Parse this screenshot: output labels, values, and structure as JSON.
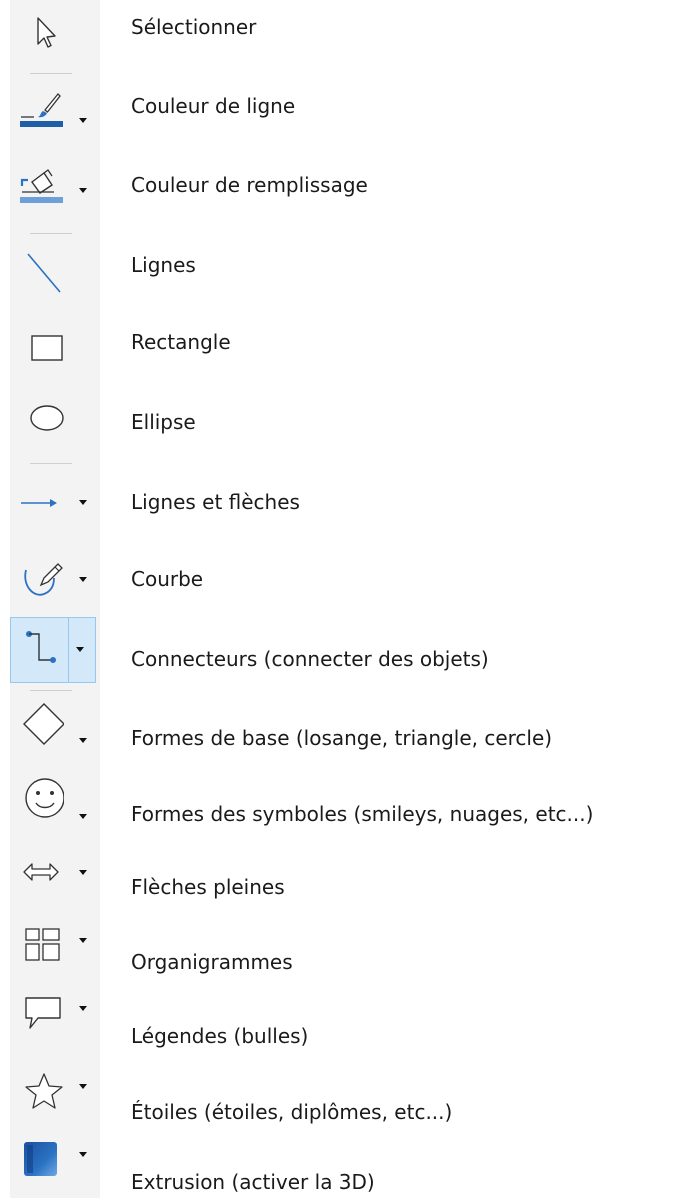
{
  "tools": [
    {
      "label": "Sélectionner"
    },
    {
      "label": "Couleur de ligne"
    },
    {
      "label": "Couleur de remplissage"
    },
    {
      "label": "Lignes"
    },
    {
      "label": "Rectangle"
    },
    {
      "label": "Ellipse"
    },
    {
      "label": "Lignes et  flèches"
    },
    {
      "label": "Courbe"
    },
    {
      "label": "Connecteurs (connecter des objets)"
    },
    {
      "label": "Formes de base (losange, triangle, cercle)"
    },
    {
      "label": "Formes des symboles (smileys, nuages, etc...)"
    },
    {
      "label": "Flèches pleines"
    },
    {
      "label": "Organigrammes"
    },
    {
      "label": "Légendes (bulles)"
    },
    {
      "label": "Étoiles (étoiles, diplômes, etc...)"
    },
    {
      "label": "Extrusion (activer la 3D)"
    }
  ],
  "colors": {
    "line_color_swatch": "#1f5fa8",
    "fill_color_swatch": "#6f9fd8",
    "icon_blue": "#2b72c2",
    "active_bg": "#d3e8f9"
  }
}
